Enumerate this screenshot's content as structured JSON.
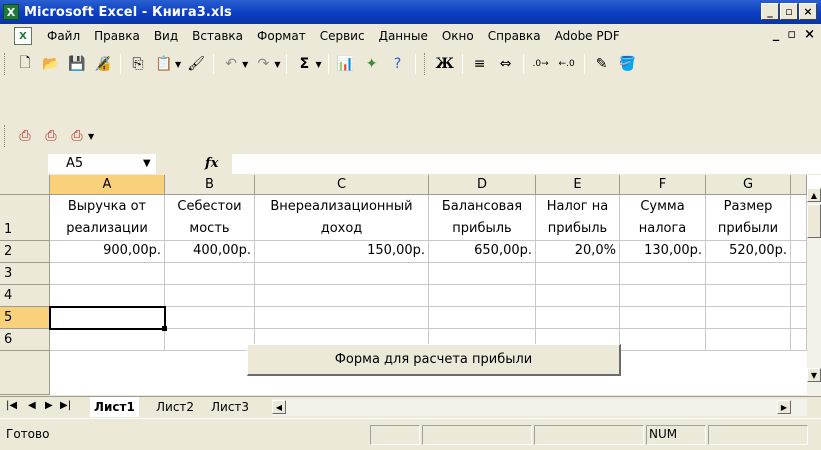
{
  "window": {
    "title": "Microsoft Excel - Книга3.xls",
    "app_icon": "X",
    "buttons": [
      "minimize",
      "restore",
      "close"
    ]
  },
  "menu": {
    "items": [
      "Файл",
      "Правка",
      "Вид",
      "Вставка",
      "Формат",
      "Сервис",
      "Данные",
      "Окно",
      "Справка",
      "Adobe PDF"
    ],
    "doc_controls": [
      "_",
      "▫",
      "×"
    ]
  },
  "formula_bar": {
    "name_box": "A5",
    "fx_label": "fx",
    "formula": ""
  },
  "columns": [
    {
      "letter": "A"
    },
    {
      "letter": "B"
    },
    {
      "letter": "C"
    },
    {
      "letter": "D"
    },
    {
      "letter": "E"
    },
    {
      "letter": "F"
    },
    {
      "letter": "G"
    }
  ],
  "rows": [
    "1",
    "2",
    "3",
    "4",
    "5",
    "6"
  ],
  "header_row": [
    [
      "Выручка от",
      "реализации"
    ],
    [
      "Себестои",
      "мость"
    ],
    [
      "Внереализационный",
      "доход"
    ],
    [
      "Балансовая",
      "прибыль"
    ],
    [
      "Налог на",
      "прибыль"
    ],
    [
      "Сумма",
      "налога"
    ],
    [
      "Размер",
      "прибыли"
    ]
  ],
  "data_row": [
    "900,00р.",
    "400,00р.",
    "150,00р.",
    "650,00р.",
    "20,0%",
    "130,00р.",
    "520,00р."
  ],
  "form_button_label": "Форма для расчета прибыли",
  "sheet_tabs": [
    "Лист1",
    "Лист2",
    "Лист3"
  ],
  "active_sheet": "Лист1",
  "status": {
    "ready": "Готово",
    "num": "NUM"
  },
  "colors": {
    "title_bar": "#0a3ec2",
    "selection_header": "#f9d17b",
    "chrome": "#ece9d8"
  }
}
